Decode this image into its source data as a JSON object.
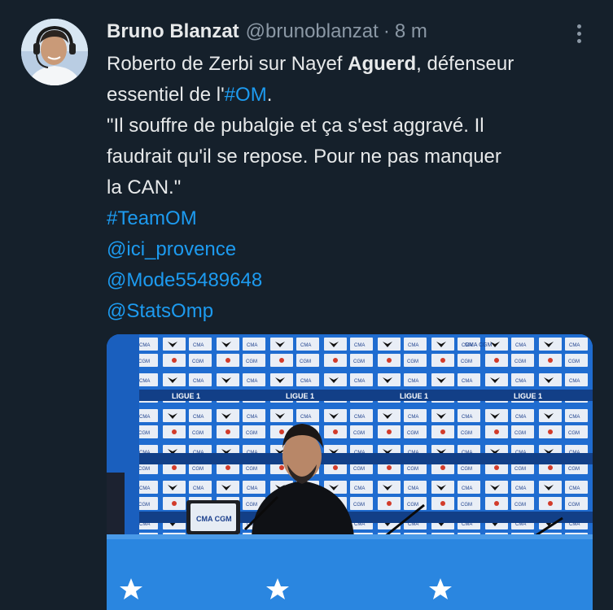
{
  "tweet": {
    "author_name": "Bruno Blanzat",
    "author_handle": "@brunoblanzat",
    "separator": "·",
    "time": "8 m",
    "line1_a": "Roberto de Zerbi sur Nayef ",
    "line1_bold": "Aguerd",
    "line1_b": ", défenseur",
    "line2_a": "essentiel de l'",
    "line2_link": "#OM",
    "line2_b": ".",
    "line3": "\"Il souffre de pubalgie et ça s'est aggravé. Il",
    "line4": "faudrait qu'il se repose. Pour ne pas manquer",
    "line5": "la CAN.\"",
    "hashtag_teamom": "#TeamOM",
    "mention_1": "@ici_provence",
    "mention_2": "@Mode55489648",
    "mention_3": "@StatsOmp"
  },
  "media": {
    "board_logo_text": "CMA CGM",
    "board_ligue_text": "LIGUE 1",
    "laptop_logo_text": "CMA CGM"
  },
  "colors": {
    "background": "#15202b",
    "text": "#e7e9ea",
    "muted": "#8b98a5",
    "link": "#1d9bf0",
    "board_blue": "#1a66c8"
  }
}
